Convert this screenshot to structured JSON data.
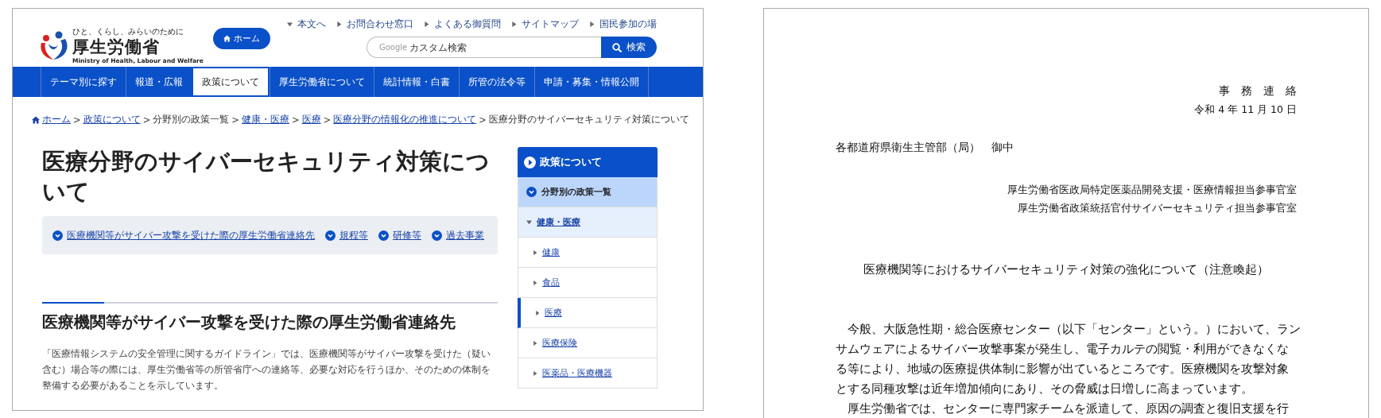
{
  "website": {
    "logo": {
      "tagline": "ひと、くらし、みらいのために",
      "name": "厚生労働省",
      "english": "Ministry of Health, Labour and Welfare"
    },
    "home_button": "ホーム",
    "utility_links": [
      {
        "label": "本文へ",
        "kind": "down"
      },
      {
        "label": "お問合わせ窓口",
        "kind": "right"
      },
      {
        "label": "よくある御質問",
        "kind": "right"
      },
      {
        "label": "サイトマップ",
        "kind": "right"
      },
      {
        "label": "国民参加の場",
        "kind": "right"
      }
    ],
    "search": {
      "brand": "Google",
      "placeholder": "カスタム検索",
      "button": "検索"
    },
    "nav": [
      {
        "label": "テーマ別に探す",
        "selected": false
      },
      {
        "label": "報道・広報",
        "selected": false
      },
      {
        "label": "政策について",
        "selected": true
      },
      {
        "label": "厚生労働省について",
        "selected": false
      },
      {
        "label": "統計情報・白書",
        "selected": false
      },
      {
        "label": "所管の法令等",
        "selected": false
      },
      {
        "label": "申請・募集・情報公開",
        "selected": false
      }
    ],
    "breadcrumb_separator": ">",
    "breadcrumb": [
      {
        "label": "ホーム",
        "link": true
      },
      {
        "label": "政策について",
        "link": true
      },
      {
        "label": "分野別の政策一覧",
        "link": false
      },
      {
        "label": "健康・医療",
        "link": true
      },
      {
        "label": "医療",
        "link": true
      },
      {
        "label": "医療分野の情報化の推進について",
        "link": true
      },
      {
        "label": "医療分野のサイバーセキュリティ対策について",
        "link": false
      }
    ],
    "title": "医療分野のサイバーセキュリティ対策について",
    "anchors": [
      "医療機関等がサイバー攻撃を受けた際の厚生労働省連絡先",
      "規程等",
      "研修等",
      "過去事業"
    ],
    "section": {
      "heading": "医療機関等がサイバー攻撃を受けた際の厚生労働省連絡先",
      "body": "「医療情報システムの安全管理に関するガイドライン」では、医療機関等がサイバー攻撃を受けた（疑い含む）場合等の際には、厚生労働省等の所管省庁への連絡等、必要な対応を行うほか、そのための体制を整備する必要があることを示しています。"
    },
    "sidebar": {
      "title": "政策について",
      "items": [
        {
          "label": "分野別の政策一覧",
          "kind": "category"
        },
        {
          "label": "健康・医療",
          "kind": "group",
          "expanded": true,
          "children": [
            {
              "label": "健康",
              "selected": false
            },
            {
              "label": "食品",
              "selected": false
            },
            {
              "label": "医療",
              "selected": true
            },
            {
              "label": "医療保険",
              "selected": false
            },
            {
              "label": "医薬品・医療機器",
              "selected": false
            }
          ]
        }
      ]
    }
  },
  "document": {
    "heading": "事　務　連　絡",
    "date": "令和 4 年 11 月 10 日",
    "addressee": "各都道府県衛生主管部（局）　御中",
    "senders": [
      "厚生労働省医政局特定医薬品開発支援・医療情報担当参事官室",
      "厚生労働省政策統括官付サイバーセキュリティ担当参事官室"
    ],
    "title": "医療機関等におけるサイバーセキュリティ対策の強化について（注意喚起）",
    "paragraphs": [
      [
        "　今般、大阪急性期・総合医療センター（以下「センター」という。）において、ラン",
        "サムウェアによるサイバー攻撃事案が発生し、電子カルテの閲覧・利用ができなくな",
        "る等により、地域の医療提供体制に影響が出ているところです。医療機関を攻撃対象",
        "とする同種攻撃は近年増加傾向にあり、その脅威は日増しに高まっています。"
      ],
      [
        "　厚生労働省では、センターに専門家チームを派遣して、原因の調査と復旧支援を行"
      ]
    ]
  }
}
